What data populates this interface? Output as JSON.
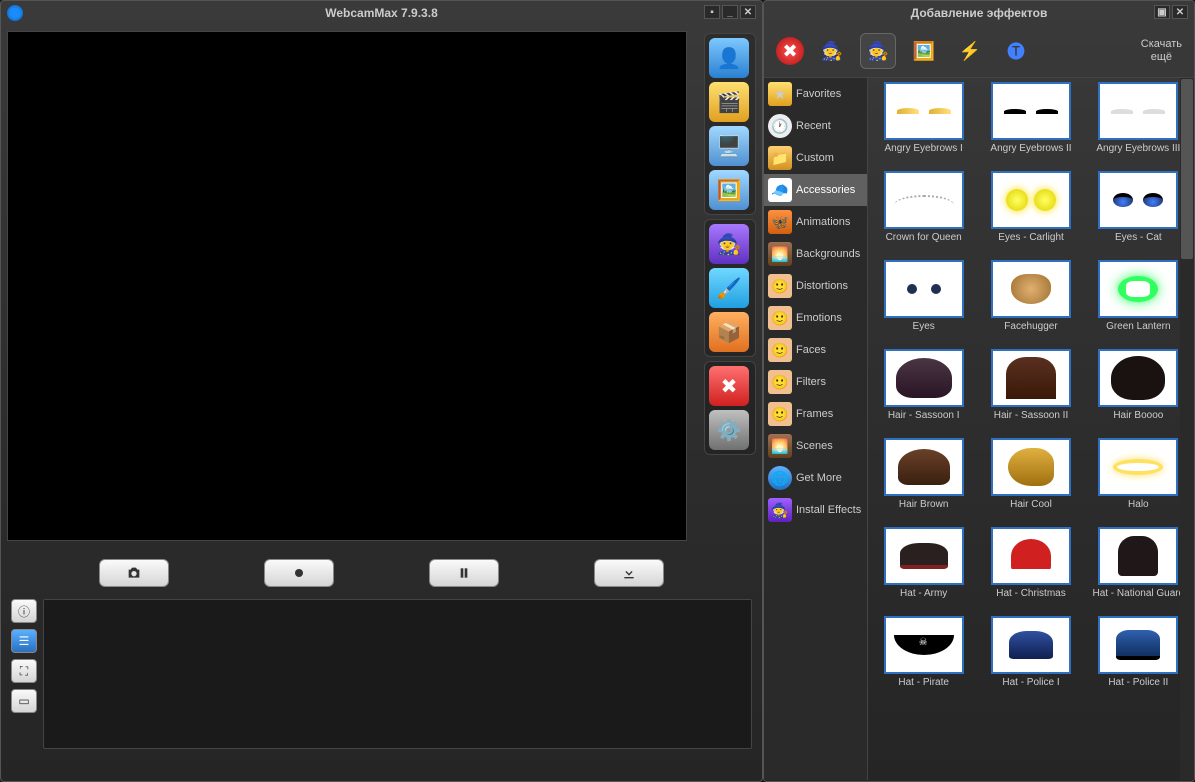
{
  "main": {
    "title": "WebcamMax  7.9.3.8",
    "controls": {
      "snapshot": "camera",
      "record": "record",
      "pause": "pause",
      "download": "download"
    },
    "side_buttons": [
      "info",
      "list",
      "fullscreen",
      "frame"
    ],
    "toolbar_group1": [
      "person",
      "video",
      "desktop",
      "image"
    ],
    "toolbar_group2": [
      "wizard",
      "brush",
      "box"
    ],
    "toolbar_group3": [
      "close",
      "gear"
    ]
  },
  "effects": {
    "title": "Добавление эффектов",
    "more_line1": "Скачать",
    "more_line2": "ещё",
    "categories": [
      {
        "label": "Favorites",
        "icon": "star"
      },
      {
        "label": "Recent",
        "icon": "clock"
      },
      {
        "label": "Custom",
        "icon": "folder"
      },
      {
        "label": "Accessories",
        "icon": "cap",
        "active": true
      },
      {
        "label": "Animations",
        "icon": "butterfly"
      },
      {
        "label": "Backgrounds",
        "icon": "bg"
      },
      {
        "label": "Distortions",
        "icon": "face"
      },
      {
        "label": "Emotions",
        "icon": "face"
      },
      {
        "label": "Faces",
        "icon": "face"
      },
      {
        "label": "Filters",
        "icon": "face"
      },
      {
        "label": "Frames",
        "icon": "face"
      },
      {
        "label": "Scenes",
        "icon": "bg"
      },
      {
        "label": "Get More",
        "icon": "globe"
      },
      {
        "label": "Install Effects",
        "icon": "wiz"
      }
    ],
    "items": [
      {
        "label": "Angry Eyebrows I",
        "art": "eyebrow-gold"
      },
      {
        "label": "Angry Eyebrows II",
        "art": "eyebrow-black"
      },
      {
        "label": "Angry Eyebrows III",
        "art": "eyebrow-white"
      },
      {
        "label": "Crown for Queen",
        "art": "crown"
      },
      {
        "label": "Eyes - Carlight",
        "art": "eyes-yellow"
      },
      {
        "label": "Eyes - Cat",
        "art": "eyes-cat"
      },
      {
        "label": "Eyes",
        "art": "eyes-dot"
      },
      {
        "label": "Facehugger",
        "art": "facehugger"
      },
      {
        "label": "Green Lantern",
        "art": "lantern"
      },
      {
        "label": "Hair - Sassoon I",
        "art": "hair-dark"
      },
      {
        "label": "Hair - Sassoon II",
        "art": "hair-bangs"
      },
      {
        "label": "Hair Boooo",
        "art": "hair-afro"
      },
      {
        "label": "Hair Brown",
        "art": "hair-brown"
      },
      {
        "label": "Hair Cool",
        "art": "hair-cool"
      },
      {
        "label": "Halo",
        "art": "halo"
      },
      {
        "label": "Hat - Army",
        "art": "hat-army"
      },
      {
        "label": "Hat - Christmas",
        "art": "hat-xmas"
      },
      {
        "label": "Hat - National Guard",
        "art": "hat-guard"
      },
      {
        "label": "Hat - Pirate",
        "art": "hat-pirate"
      },
      {
        "label": "Hat - Police I",
        "art": "hat-police1"
      },
      {
        "label": "Hat - Police II",
        "art": "hat-police2"
      }
    ]
  }
}
